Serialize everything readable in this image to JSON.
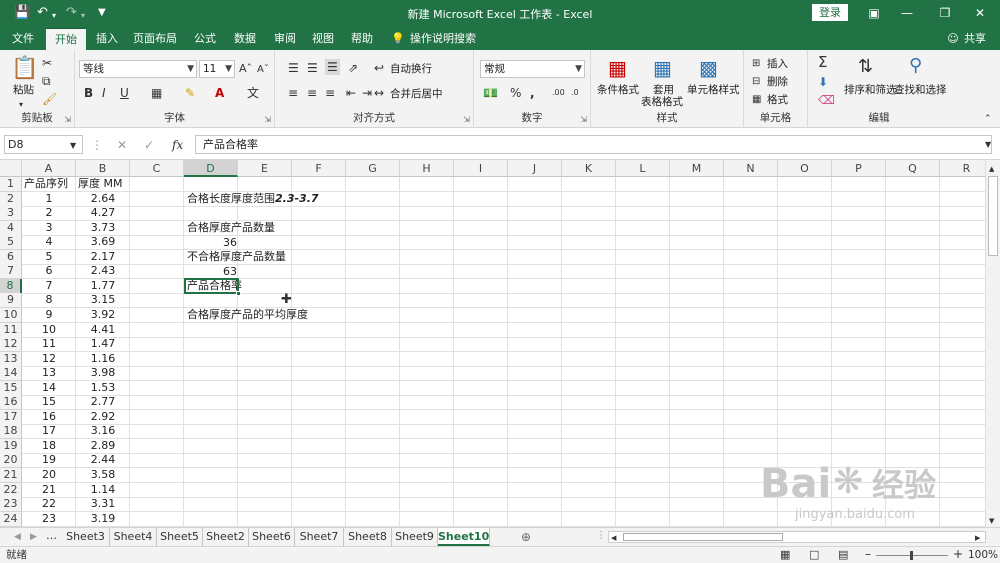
{
  "titlebar": {
    "title": "新建 Microsoft Excel 工作表  -  Excel",
    "login": "登录",
    "save_icon": "save-icon",
    "undo_icon": "undo-icon",
    "redo_icon": "redo-icon"
  },
  "tabs": [
    "文件",
    "开始",
    "插入",
    "页面布局",
    "公式",
    "数据",
    "审阅",
    "视图",
    "帮助"
  ],
  "tell_me": "操作说明搜索",
  "share": "共享",
  "ribbon": {
    "clipboard": {
      "label": "剪贴板",
      "paste": "粘贴"
    },
    "font": {
      "label": "字体",
      "name": "等线",
      "size": "11"
    },
    "align": {
      "label": "对齐方式",
      "wrap": "自动换行",
      "merge": "合并后居中"
    },
    "number": {
      "label": "数字",
      "format": "常规"
    },
    "styles": {
      "label": "样式",
      "cond": "条件格式",
      "table1": "套用",
      "table2": "表格格式",
      "cell": "单元格样式"
    },
    "cells": {
      "label": "单元格",
      "insert": "插入",
      "delete": "删除",
      "format": "格式"
    },
    "editing": {
      "label": "编辑",
      "sort": "排序和筛选",
      "find": "查找和选择"
    }
  },
  "formula_bar": {
    "namebox": "D8",
    "fx": "fx",
    "content": "产品合格率"
  },
  "columns": [
    "A",
    "B",
    "C",
    "D",
    "E",
    "F",
    "G",
    "H",
    "I",
    "J",
    "K",
    "L",
    "M",
    "N",
    "O",
    "P",
    "Q",
    "R"
  ],
  "rows": [
    "1",
    "2",
    "3",
    "4",
    "5",
    "6",
    "7",
    "8",
    "9",
    "10",
    "11",
    "12",
    "13",
    "14",
    "15",
    "16",
    "17",
    "18",
    "19",
    "20",
    "21",
    "22",
    "23",
    "24"
  ],
  "cells": {
    "A": [
      "产品序列",
      "1",
      "2",
      "3",
      "4",
      "5",
      "6",
      "7",
      "8",
      "9",
      "10",
      "11",
      "12",
      "13",
      "14",
      "15",
      "16",
      "17",
      "18",
      "19",
      "20",
      "21",
      "22",
      "23"
    ],
    "B": [
      "厚度 MM",
      "2.64",
      "4.27",
      "3.73",
      "3.69",
      "2.17",
      "2.43",
      "1.77",
      "3.15",
      "3.92",
      "4.41",
      "1.47",
      "1.16",
      "3.98",
      "1.53",
      "2.77",
      "2.92",
      "3.16",
      "2.89",
      "2.44",
      "3.58",
      "1.14",
      "3.31",
      "3.19"
    ],
    "D2_text": "合格长度厚度范围",
    "D2_range": "2.3-3.7",
    "D4": "合格厚度产品数量",
    "D5": "36",
    "D6": "不合格厚度产品数量",
    "D7": "63",
    "D8": "产品合格率",
    "D10": "合格厚度产品的平均厚度"
  },
  "sheets": [
    "Sheet3",
    "Sheet4",
    "Sheet5",
    "Sheet2",
    "Sheet6",
    "Sheet7",
    "Sheet8",
    "Sheet9",
    "Sheet10"
  ],
  "active_sheet": "Sheet10",
  "status": {
    "mode": "就绪",
    "zoom": "100%"
  },
  "watermark": {
    "brand": "Bai",
    "brand2": "经验",
    "url": "jingyan.baidu.com"
  },
  "colors": {
    "excel_green": "#217346"
  }
}
